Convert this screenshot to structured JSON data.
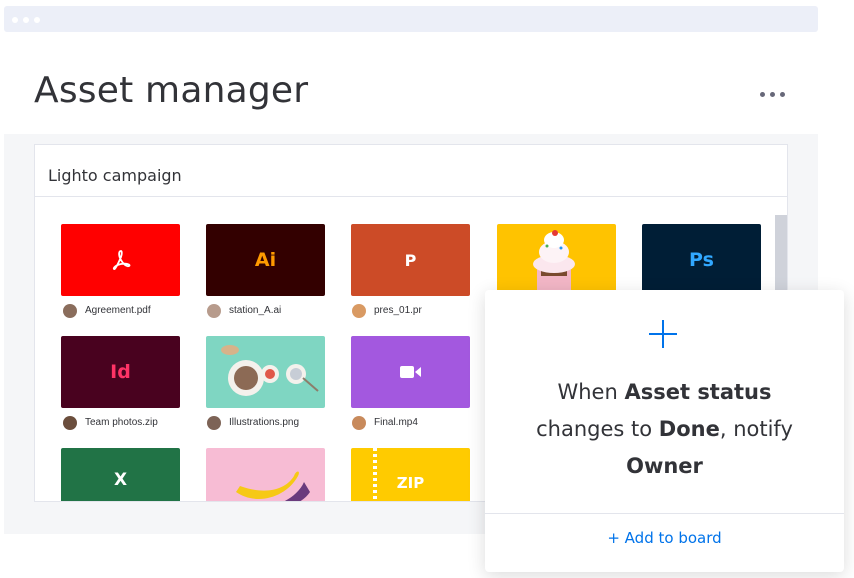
{
  "window": {
    "title_bar_icon": "window-dots"
  },
  "page": {
    "title": "Asset manager",
    "more_icon": "more-horizontal-icon"
  },
  "board": {
    "name": "Lighto campaign",
    "files": [
      {
        "name": "Agreement.pdf",
        "type": "pdf",
        "glyph": "",
        "color": "#ff0000"
      },
      {
        "name": "station_A.ai",
        "type": "ai",
        "glyph": "Ai",
        "color": "#330000"
      },
      {
        "name": "pres_01.pr",
        "type": "pptx",
        "glyph": "P",
        "color": "#cc4b27"
      },
      {
        "name": "",
        "type": "image-cupcake",
        "glyph": "",
        "color": "#ffc300"
      },
      {
        "name": "",
        "type": "psd",
        "glyph": "Ps",
        "color": "#001e36"
      },
      {
        "name": "Team photos.zip",
        "type": "indd",
        "glyph": "Id",
        "color": "#49021f"
      },
      {
        "name": "Illustrations.png",
        "type": "image-food",
        "glyph": "",
        "color": "#7fd6c2"
      },
      {
        "name": "Final.mp4",
        "type": "video",
        "glyph": "",
        "color": "#a358df"
      },
      {
        "name": "",
        "type": "xlsx",
        "glyph": "X",
        "color": "#217346"
      },
      {
        "name": "",
        "type": "image-banana",
        "glyph": "",
        "color": "#f7bcd4"
      },
      {
        "name": "",
        "type": "zip",
        "glyph": "ZIP",
        "color": "#ffcb00"
      }
    ]
  },
  "automation": {
    "when": "When",
    "field": "Asset status",
    "changes_to": "changes to",
    "value": "Done",
    "notify": ", notify",
    "target": "Owner",
    "cta": "+ Add to board",
    "accent": "#0073ea"
  }
}
